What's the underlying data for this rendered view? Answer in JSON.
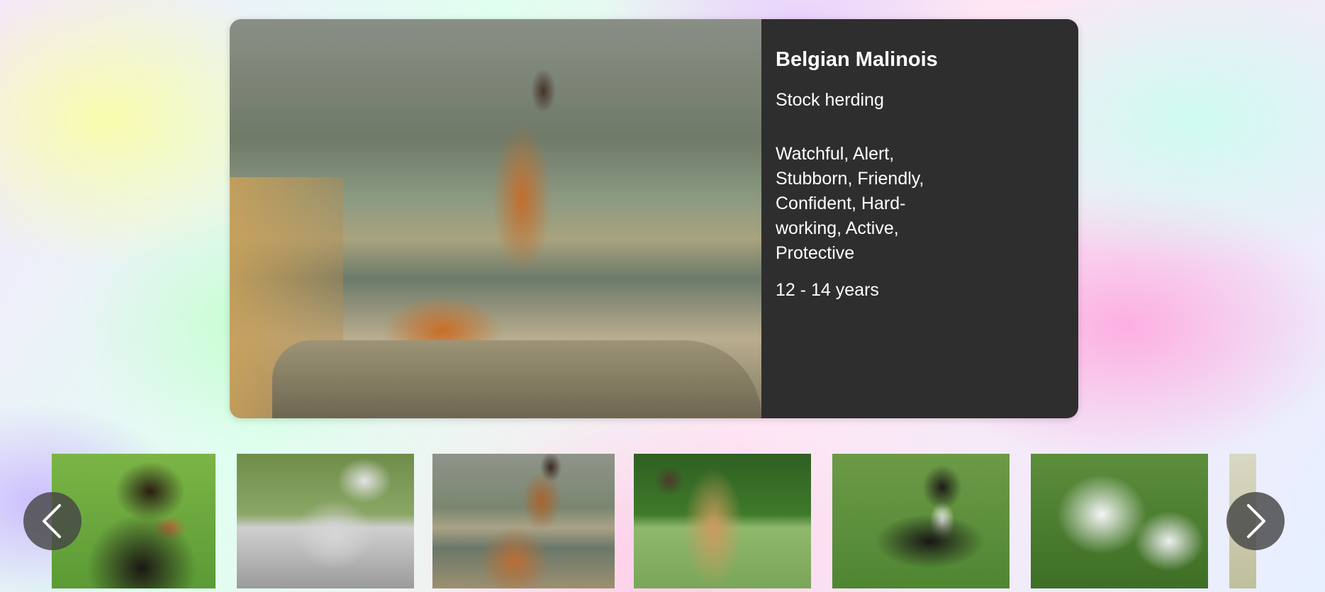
{
  "featured": {
    "name": "Belgian Malinois",
    "group": "Stock herding",
    "temperament": "Watchful, Alert, Stubborn, Friendly, Confident, Hard-working, Active, Protective",
    "life_span": "12 - 14 years",
    "info_bg_color": "#2e2e2f"
  },
  "carousel": {
    "prev_icon": "chevron-left-icon",
    "next_icon": "chevron-right-icon"
  }
}
